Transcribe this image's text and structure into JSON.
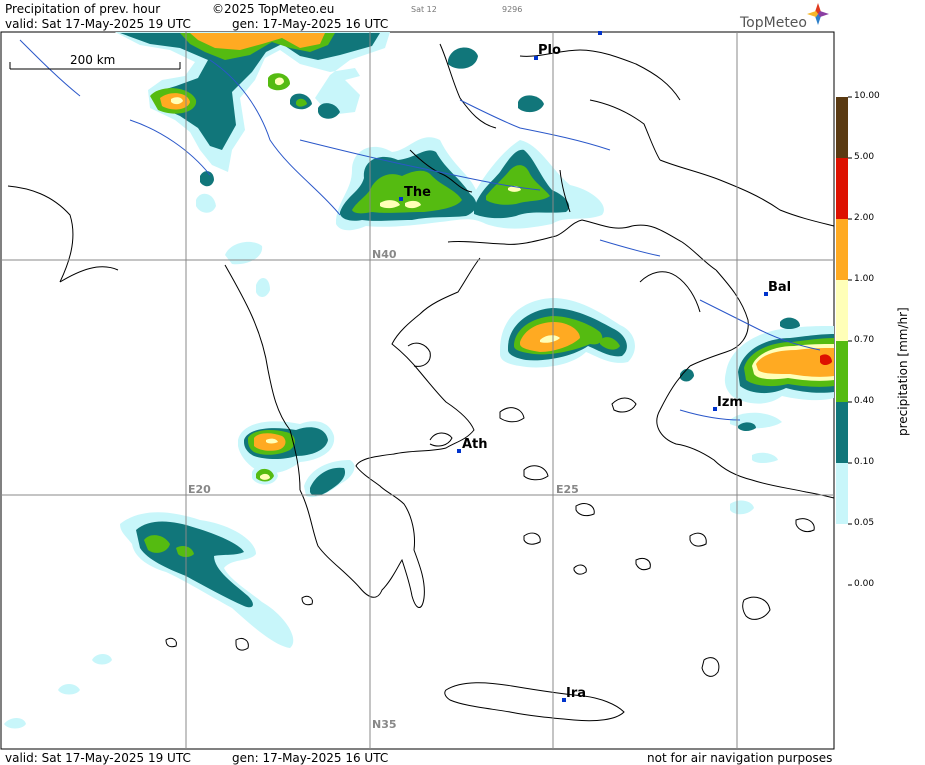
{
  "header": {
    "title": "Precipitation of prev. hour",
    "copyright": "©2025 TopMeteo.eu",
    "satellite": "Sat 12",
    "code": "9296",
    "valid": "valid:  Sat  17-May-2025  19 UTC",
    "gen": "gen: 17-May-2025 16 UTC",
    "brand": "TopMeteo"
  },
  "footer": {
    "valid": "valid:  Sat  17-May-2025  19 UTC",
    "gen": "gen: 17-May-2025 16 UTC",
    "disclaimer": "not for air navigation purposes"
  },
  "map": {
    "scale_label": "200 km",
    "cities": [
      {
        "code": "Plo"
      },
      {
        "code": "The"
      },
      {
        "code": "Bal"
      },
      {
        "code": "Izm"
      },
      {
        "code": "Ath"
      },
      {
        "code": "Ira"
      }
    ],
    "grid_labels": [
      "N40",
      "E20",
      "E25",
      "N35"
    ]
  },
  "legend": {
    "title": "precipitation [mm/hr]",
    "ticks": [
      "10.00",
      "5.00",
      "2.00",
      "1.00",
      "0.70",
      "0.40",
      "0.10",
      "0.05",
      "0.00"
    ],
    "colors": [
      "#5a3a12",
      "#dd1100",
      "#ffaa22",
      "#ffffb8",
      "#55bb11",
      "#11767a",
      "#c8f6fa"
    ]
  }
}
